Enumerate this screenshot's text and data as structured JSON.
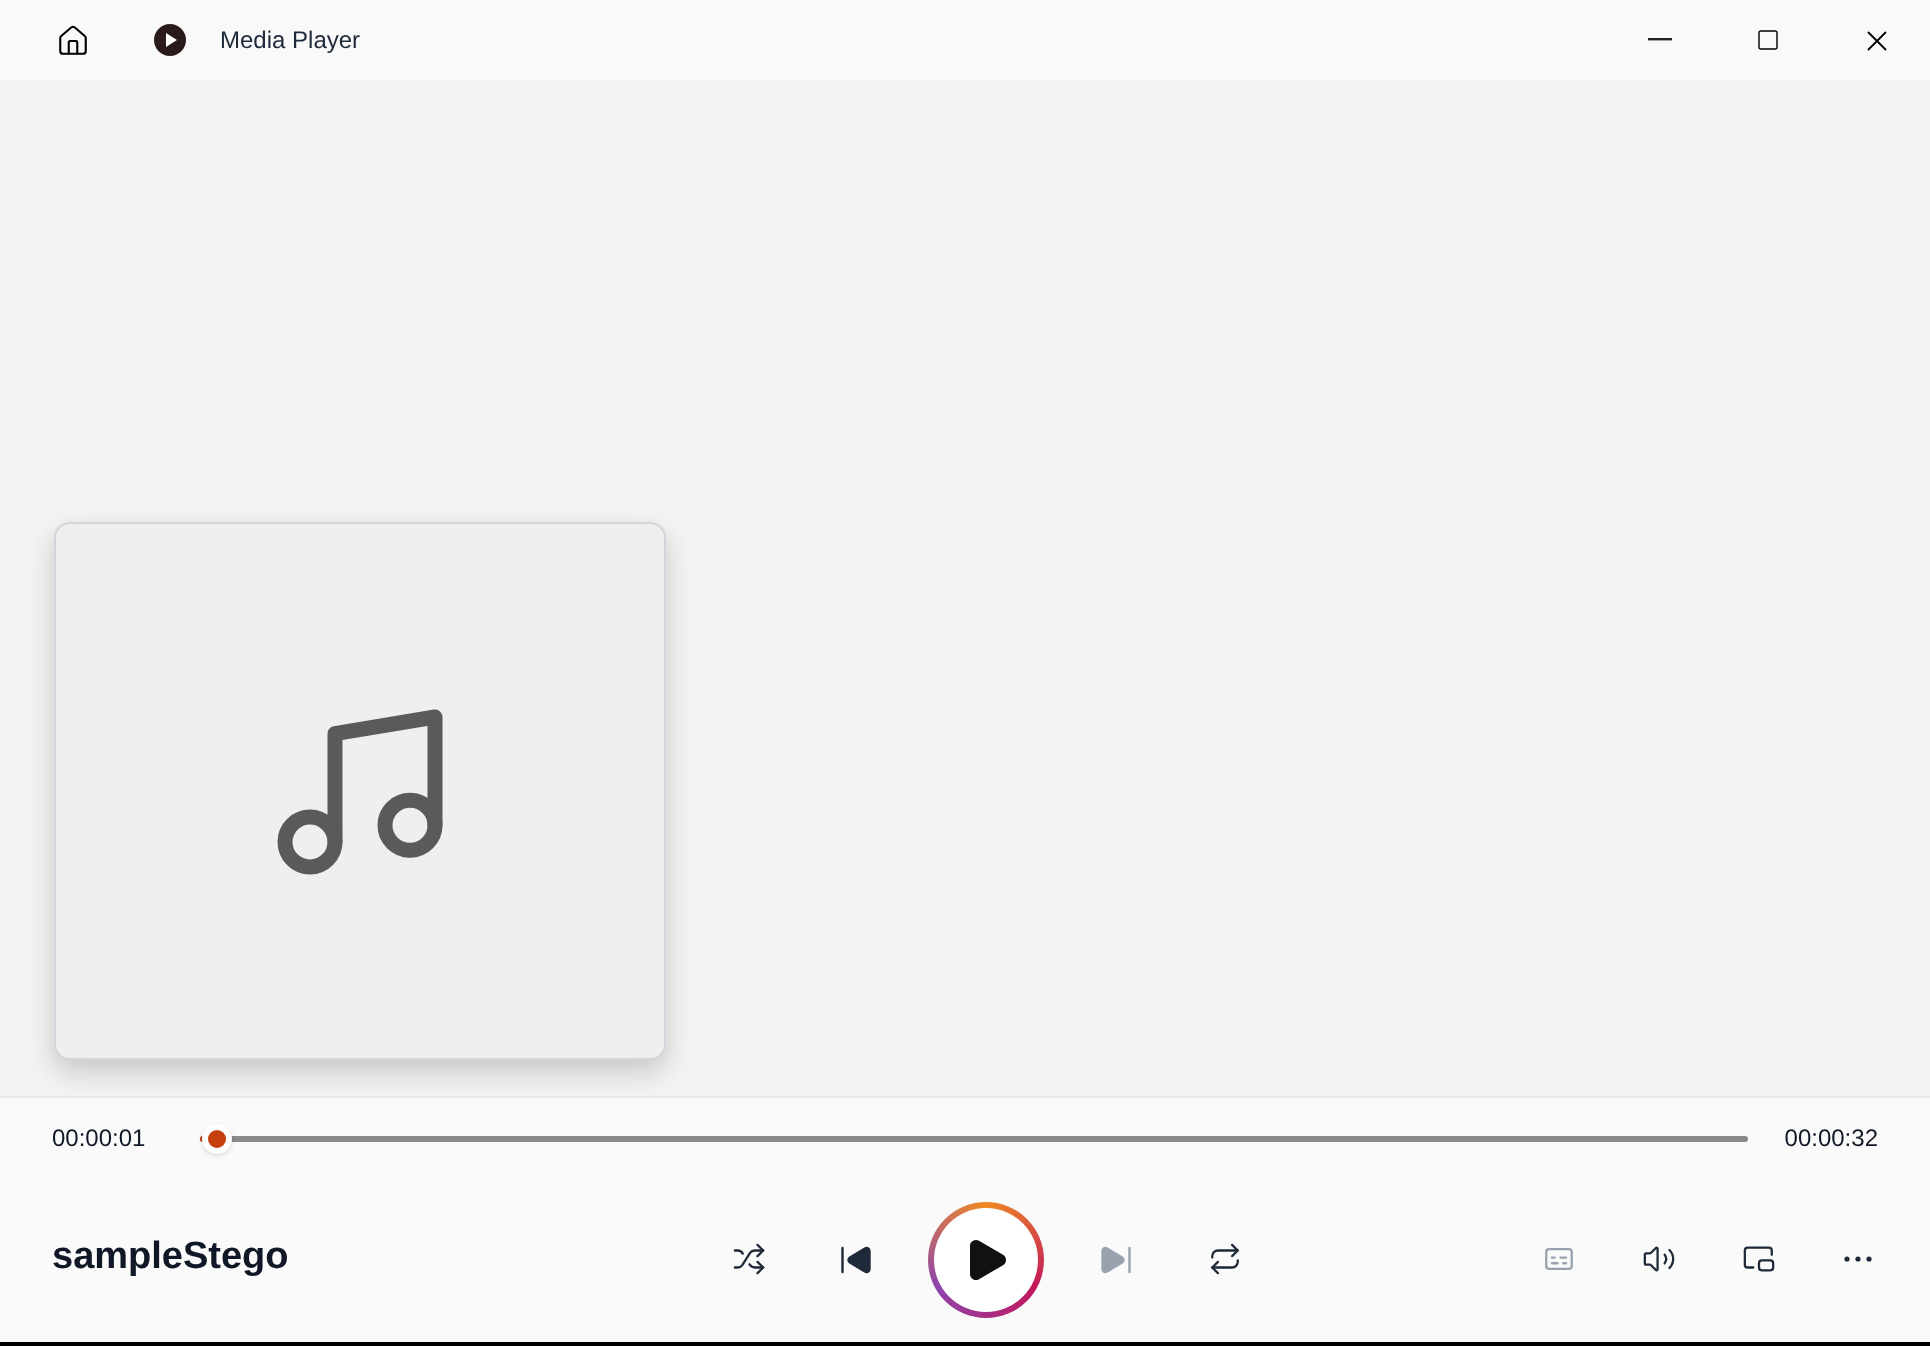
{
  "window": {
    "title": "Media Player"
  },
  "track": {
    "title": "sampleStego",
    "elapsed": "00:00:01",
    "duration": "00:00:32",
    "level": 0.01
  },
  "controls": [
    {
      "kind": "shuffle",
      "on": false,
      "disabled": false
    },
    {
      "kind": "previous",
      "disabled": false
    },
    {
      "kind": "play",
      "disabled": false
    },
    {
      "kind": "next",
      "disabled": true
    },
    {
      "kind": "repeat",
      "on": false,
      "disabled": false
    }
  ],
  "extras": [
    {
      "kind": "captions",
      "disabled": true
    },
    {
      "kind": "volume",
      "disabled": false
    },
    {
      "kind": "miniplayer",
      "disabled": false
    },
    {
      "kind": "more",
      "disabled": false
    }
  ]
}
